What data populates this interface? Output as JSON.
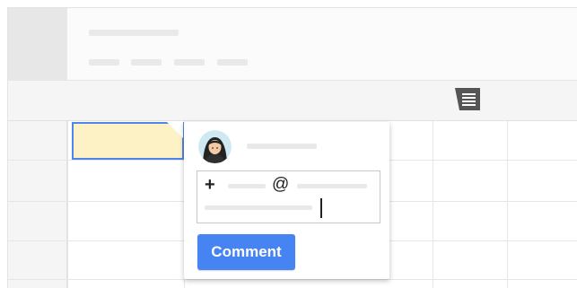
{
  "toolbar": {
    "comment_icon": "comment-icon"
  },
  "selected_cell": {
    "fill_color": "#fdf1c6",
    "border_color": "#4f86ec"
  },
  "comment_popup": {
    "avatar": "user-avatar",
    "input_icons": {
      "plus": "+",
      "mention": "@"
    },
    "submit_label": "Comment",
    "submit_color": "#4684f3"
  }
}
